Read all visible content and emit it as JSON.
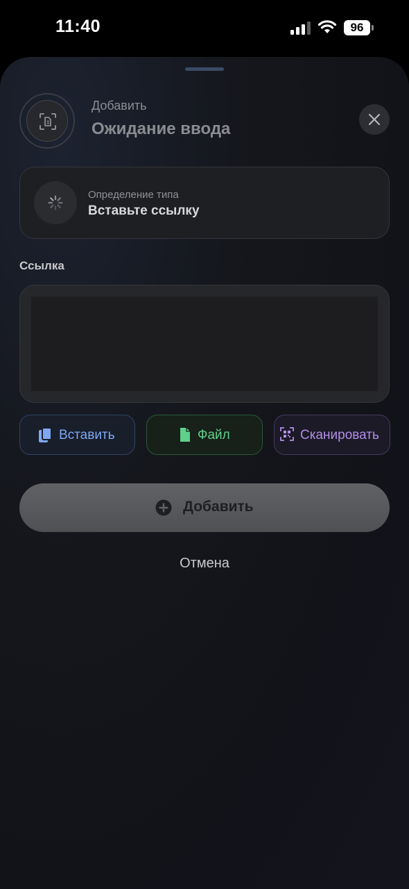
{
  "status_bar": {
    "time": "11:40",
    "battery_level": "96"
  },
  "header": {
    "subtitle": "Добавить",
    "title": "Ожидание ввода",
    "icon": "document-scan-icon",
    "close_icon": "close-icon"
  },
  "type_card": {
    "label": "Определение типа",
    "value": "Вставьте ссылку",
    "icon": "loading-spinner-icon"
  },
  "link_field": {
    "label": "Ссылка",
    "value": "",
    "placeholder": ""
  },
  "actions": {
    "paste": {
      "label": "Вставить",
      "icon": "clipboard-icon",
      "color": "#7fa8f4"
    },
    "file": {
      "label": "Файл",
      "icon": "file-icon",
      "color": "#5fd18a"
    },
    "scan": {
      "label": "Сканировать",
      "icon": "qr-scan-icon",
      "color": "#b28ee8"
    }
  },
  "submit": {
    "label": "Добавить",
    "icon": "plus-circle-icon"
  },
  "cancel": {
    "label": "Отмена"
  }
}
